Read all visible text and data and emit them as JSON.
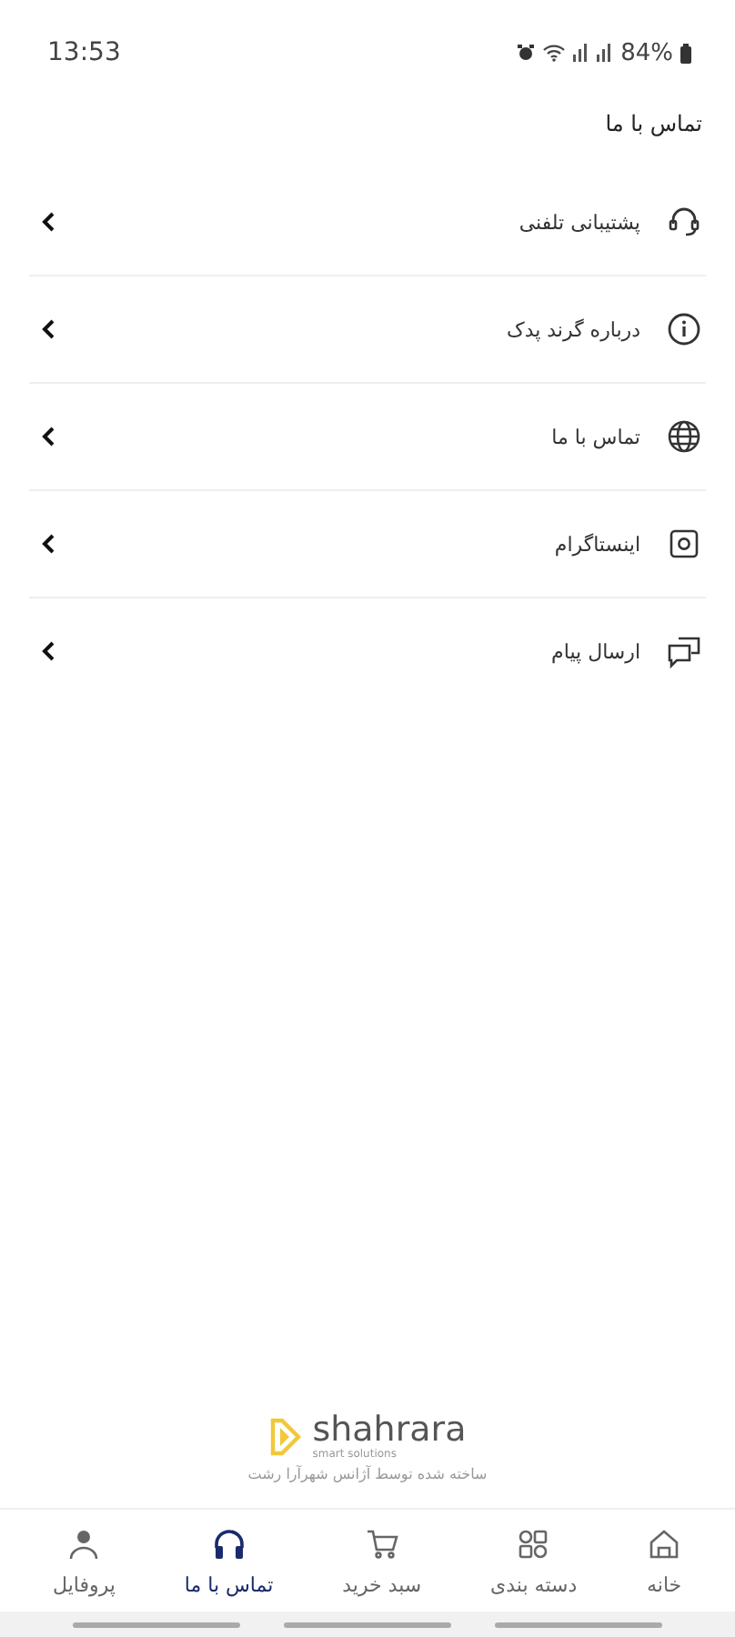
{
  "status_bar": {
    "time": "13:53",
    "battery": "84%"
  },
  "page_title": "تماس با ما",
  "menu": [
    {
      "label": "پشتیبانی تلفنی",
      "kind": "headset"
    },
    {
      "label": "درباره گرند پدک",
      "kind": "info"
    },
    {
      "label": "تماس با ما",
      "kind": "globe"
    },
    {
      "label": "اینستاگرام",
      "kind": "instagram"
    },
    {
      "label": "ارسال پیام",
      "kind": "chat"
    }
  ],
  "footer": {
    "brand": "shahrara",
    "tagline": "smart solutions",
    "credit": "ساخته شده توسط آژانس شهرآرا رشت"
  },
  "nav": [
    {
      "label": "خانه",
      "kind": "home",
      "selected": false
    },
    {
      "label": "دسته بندی",
      "kind": "grid",
      "selected": false
    },
    {
      "label": "سبد خرید",
      "kind": "cart",
      "selected": false
    },
    {
      "label": "تماس با ما",
      "kind": "headphones",
      "selected": true
    },
    {
      "label": "پروفایل",
      "kind": "person",
      "selected": false
    }
  ]
}
